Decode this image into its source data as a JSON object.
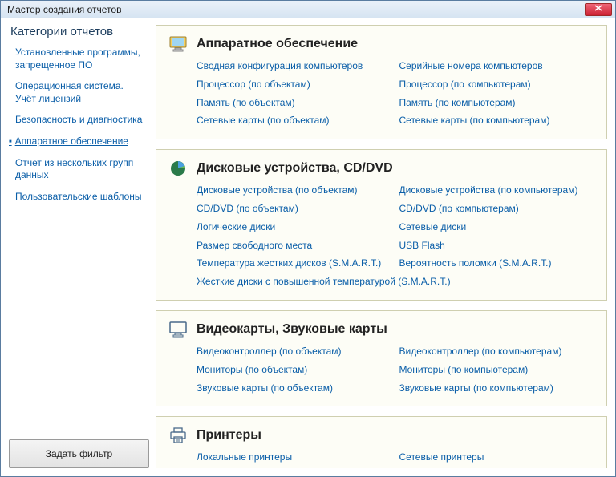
{
  "window": {
    "title": "Мастер создания отчетов"
  },
  "sidebar": {
    "heading": "Категории отчетов",
    "items": [
      {
        "label": "Установленные программы, запрещенное ПО",
        "active": false
      },
      {
        "label": "Операционная система. Учёт лицензий",
        "active": false
      },
      {
        "label": "Безопасность и диагностика",
        "active": false
      },
      {
        "label": "Аппаратное обеспечение",
        "active": true
      },
      {
        "label": "Отчет из нескольких групп данных",
        "active": false
      },
      {
        "label": "Пользовательские шаблоны",
        "active": false
      }
    ],
    "filter_button": "Задать фильтр"
  },
  "sections": [
    {
      "icon": "monitor-color-icon",
      "title": "Аппаратное обеспечение",
      "links": [
        {
          "label": "Сводная конфигурация компьютеров",
          "col": 1
        },
        {
          "label": "Серийные номера компьютеров",
          "col": 2
        },
        {
          "label": "Процессор (по объектам)",
          "col": 1
        },
        {
          "label": "Процессор (по компьютерам)",
          "col": 2
        },
        {
          "label": "Память (по объектам)",
          "col": 1
        },
        {
          "label": "Память (по компьютерам)",
          "col": 2
        },
        {
          "label": "Сетевые карты (по объектам)",
          "col": 1
        },
        {
          "label": "Сетевые карты (по компьютерам)",
          "col": 2
        }
      ]
    },
    {
      "icon": "pie-chart-icon",
      "title": "Дисковые устройства, CD/DVD",
      "links": [
        {
          "label": "Дисковые устройства (по объектам)",
          "col": 1
        },
        {
          "label": "Дисковые устройства (по компьютерам)",
          "col": 2
        },
        {
          "label": "CD/DVD (по объектам)",
          "col": 1
        },
        {
          "label": "CD/DVD (по компьютерам)",
          "col": 2
        },
        {
          "label": "Логические диски",
          "col": 1
        },
        {
          "label": "Сетевые диски",
          "col": 2
        },
        {
          "label": "Размер свободного места",
          "col": 1
        },
        {
          "label": "USB Flash",
          "col": 2
        },
        {
          "label": "Температура жестких дисков (S.M.A.R.T.)",
          "col": 1
        },
        {
          "label": "Вероятность поломки (S.M.A.R.T.)",
          "col": 2
        },
        {
          "label": "Жесткие диски с повышенной температурой (S.M.A.R.T.)",
          "col": 1,
          "full": true
        }
      ]
    },
    {
      "icon": "monitor-outline-icon",
      "title": "Видеокарты, Звуковые карты",
      "links": [
        {
          "label": "Видеоконтроллер (по объектам)",
          "col": 1
        },
        {
          "label": "Видеоконтроллер (по компьютерам)",
          "col": 2
        },
        {
          "label": "Мониторы (по объектам)",
          "col": 1
        },
        {
          "label": "Мониторы (по компьютерам)",
          "col": 2
        },
        {
          "label": "Звуковые карты (по объектам)",
          "col": 1
        },
        {
          "label": "Звуковые карты (по компьютерам)",
          "col": 2
        }
      ]
    },
    {
      "icon": "printer-icon",
      "title": "Принтеры",
      "links": [
        {
          "label": "Локальные принтеры",
          "col": 1
        },
        {
          "label": "Сетевые принтеры",
          "col": 2
        }
      ]
    }
  ],
  "colors": {
    "link": "#0a5ea8",
    "section_bg": "#fdfdf6",
    "section_border": "#cfcfb0"
  }
}
